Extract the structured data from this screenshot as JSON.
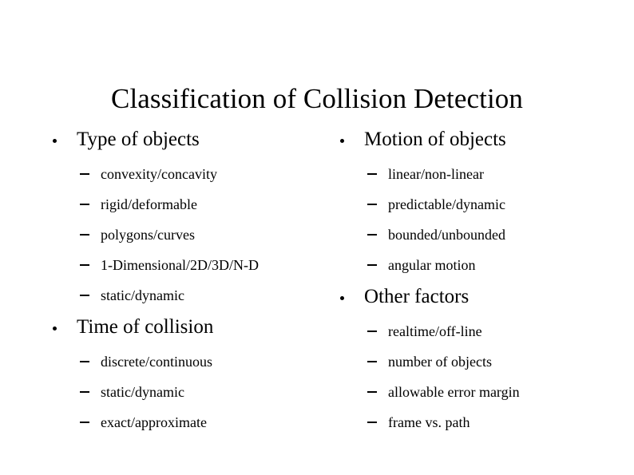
{
  "slide": {
    "title": "Classification of Collision Detection",
    "background_color": "#ffffff",
    "text_color": "#000000",
    "bullet_glyph": "dot",
    "sub_bullet_glyph": "en-dash"
  },
  "columns": {
    "left": [
      {
        "heading": "Type of objects",
        "items": [
          "convexity/concavity",
          "rigid/deformable",
          "polygons/curves",
          "1-Dimensional/2D/3D/N-D",
          "static/dynamic"
        ]
      },
      {
        "heading": "Time of collision",
        "items": [
          "discrete/continuous",
          "static/dynamic",
          "exact/approximate"
        ]
      }
    ],
    "right": [
      {
        "heading": "Motion of objects",
        "items": [
          "linear/non-linear",
          "predictable/dynamic",
          "bounded/unbounded",
          "angular motion"
        ]
      },
      {
        "heading": "Other factors",
        "items": [
          "realtime/off-line",
          "number of objects",
          "allowable error margin",
          "frame vs. path"
        ]
      }
    ]
  }
}
